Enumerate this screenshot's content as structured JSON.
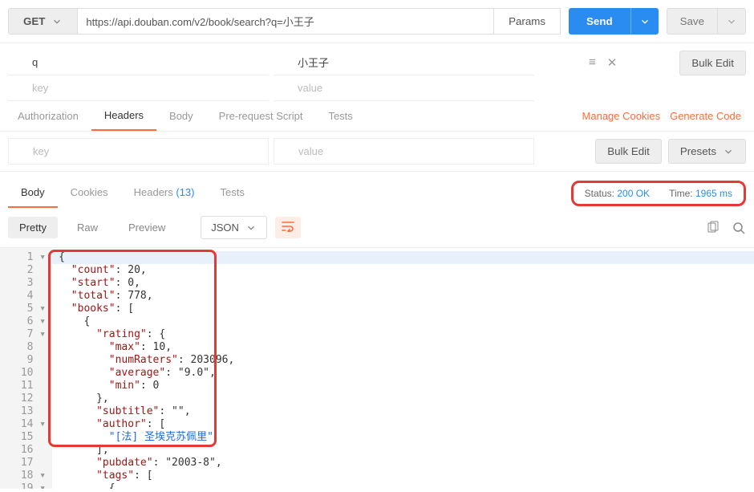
{
  "toolbar": {
    "method": "GET",
    "url": "https://api.douban.com/v2/book/search?q=小王子",
    "params_label": "Params",
    "send_label": "Send",
    "save_label": "Save"
  },
  "params": {
    "rows": [
      {
        "key": "q",
        "value": "小王子"
      }
    ],
    "new_key_placeholder": "key",
    "new_value_placeholder": "value",
    "bulk_edit_label": "Bulk Edit"
  },
  "request_tabs": {
    "items": [
      "Authorization",
      "Headers",
      "Body",
      "Pre-request Script",
      "Tests"
    ],
    "active": "Headers",
    "links": {
      "manage_cookies": "Manage Cookies",
      "generate_code": "Generate Code"
    }
  },
  "headers": {
    "key_placeholder": "key",
    "value_placeholder": "value",
    "bulk_edit_label": "Bulk Edit",
    "presets_label": "Presets"
  },
  "response": {
    "tabs": {
      "body": "Body",
      "cookies": "Cookies",
      "headers": "Headers",
      "headers_count": "(13)",
      "tests": "Tests"
    },
    "status_label": "Status:",
    "status_value": "200 OK",
    "time_label": "Time:",
    "time_value": "1965 ms"
  },
  "view": {
    "pretty": "Pretty",
    "raw": "Raw",
    "preview": "Preview",
    "format": "JSON"
  },
  "code_lines": [
    "{",
    "  \"count\": 20,",
    "  \"start\": 0,",
    "  \"total\": 778,",
    "  \"books\": [",
    "    {",
    "      \"rating\": {",
    "        \"max\": 10,",
    "        \"numRaters\": 203096,",
    "        \"average\": \"9.0\",",
    "        \"min\": 0",
    "      },",
    "      \"subtitle\": \"\",",
    "      \"author\": [",
    "        \"[法] 圣埃克苏佩里\"",
    "      ],",
    "      \"pubdate\": \"2003-8\",",
    "      \"tags\": [",
    "        {"
  ]
}
